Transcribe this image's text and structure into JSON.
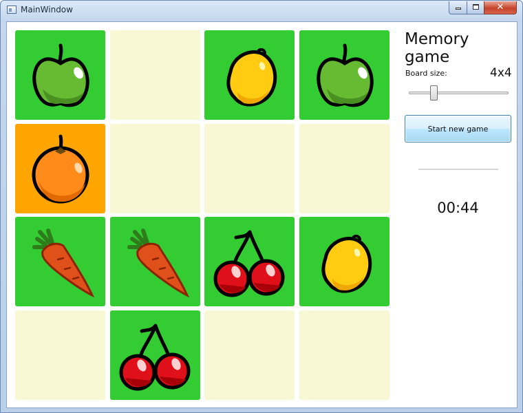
{
  "window": {
    "title": "MainWindow",
    "controls": [
      "minimize-icon",
      "maximize-icon",
      "close-icon"
    ],
    "close_glyph": "✕"
  },
  "panel": {
    "title": "Memory game",
    "board_size_label": "Board size:",
    "board_size_value": "4x4",
    "board_size_slider_level": 0.25,
    "start_button_label": "Start new game",
    "timer": "00:44"
  },
  "colors": {
    "revealed": "#33cc33",
    "selected": "#ffa500",
    "hidden": "#f8f8d4"
  },
  "board": {
    "rows": 4,
    "cols": 4,
    "tiles": [
      {
        "state": "revealed",
        "fruit": "apple"
      },
      {
        "state": "hidden",
        "fruit": ""
      },
      {
        "state": "revealed",
        "fruit": "lemon"
      },
      {
        "state": "revealed",
        "fruit": "apple"
      },
      {
        "state": "selected",
        "fruit": "orange"
      },
      {
        "state": "hidden",
        "fruit": ""
      },
      {
        "state": "hidden",
        "fruit": ""
      },
      {
        "state": "hidden",
        "fruit": ""
      },
      {
        "state": "revealed",
        "fruit": "carrot"
      },
      {
        "state": "revealed",
        "fruit": "carrot"
      },
      {
        "state": "revealed",
        "fruit": "cherries"
      },
      {
        "state": "revealed",
        "fruit": "lemon"
      },
      {
        "state": "hidden",
        "fruit": ""
      },
      {
        "state": "revealed",
        "fruit": "cherries"
      },
      {
        "state": "hidden",
        "fruit": ""
      },
      {
        "state": "hidden",
        "fruit": ""
      }
    ]
  }
}
